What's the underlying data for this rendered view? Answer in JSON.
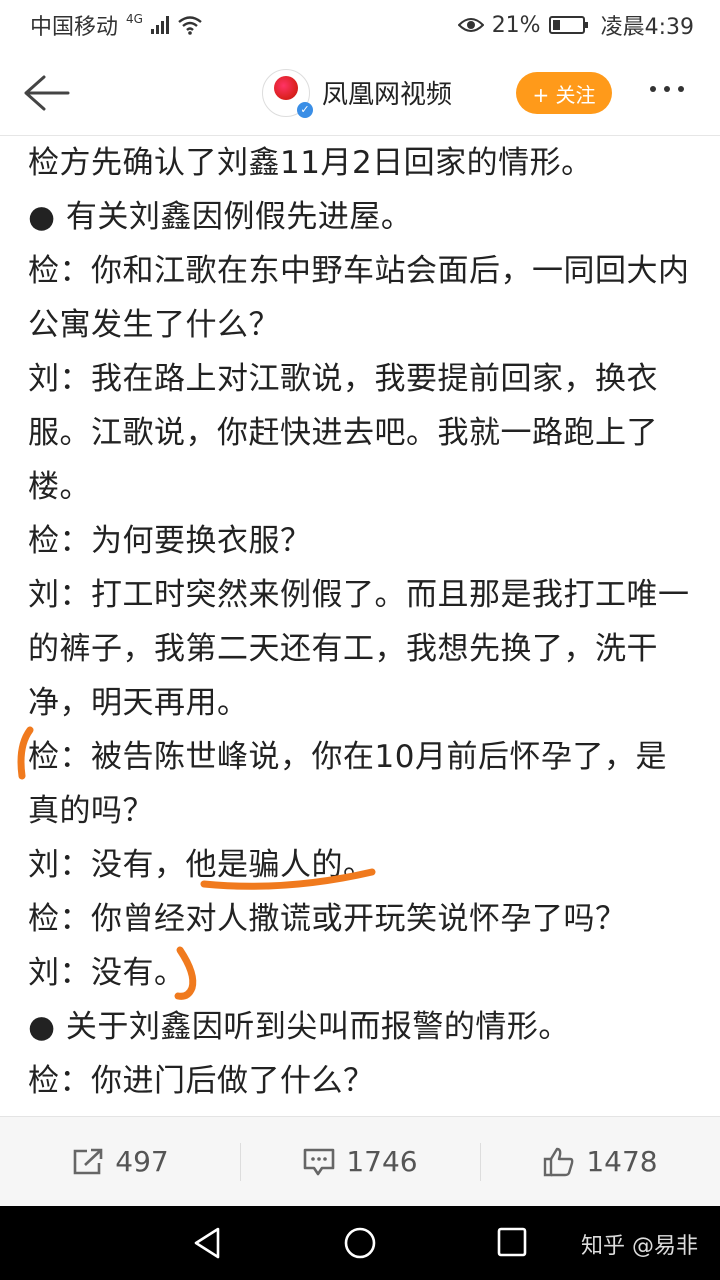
{
  "status_bar": {
    "carrier": "中国移动",
    "network": "4G",
    "battery_pct": "21%",
    "time": "凌晨4:39",
    "icons": [
      "signal-icon",
      "wifi-icon",
      "eye-icon",
      "battery-icon"
    ]
  },
  "nav": {
    "channel_name": "凤凰网视频",
    "follow_label": "+ 关注"
  },
  "content": {
    "paragraphs": [
      "检方先确认了刘鑫11月2日回家的情形。",
      "● 有关刘鑫因例假先进屋。",
      "检：你和江歌在东中野车站会面后，一同回大内公寓发生了什么？",
      "刘：我在路上对江歌说，我要提前回家，换衣服。江歌说，你赶快进去吧。我就一路跑上了楼。",
      "检：为何要换衣服？",
      "刘：打工时突然来例假了。而且那是我打工唯一的裤子，我第二天还有工，我想先换了，洗干净，明天再用。",
      "检：被告陈世峰说，你在10月前后怀孕了，是真的吗？",
      "刘：没有，他是骗人的。",
      "检：你曾经对人撒谎或开玩笑说怀孕了吗？",
      "刘：没有。",
      "● 关于刘鑫因听到尖叫而报警的情形。",
      "检：你进门后做了什么？"
    ]
  },
  "actions": {
    "share_count": "497",
    "comment_count": "1746",
    "like_count": "1478"
  },
  "watermark": "知乎 @易非",
  "colors": {
    "accent": "#ff9a1a",
    "annotation": "#f07a1e"
  }
}
